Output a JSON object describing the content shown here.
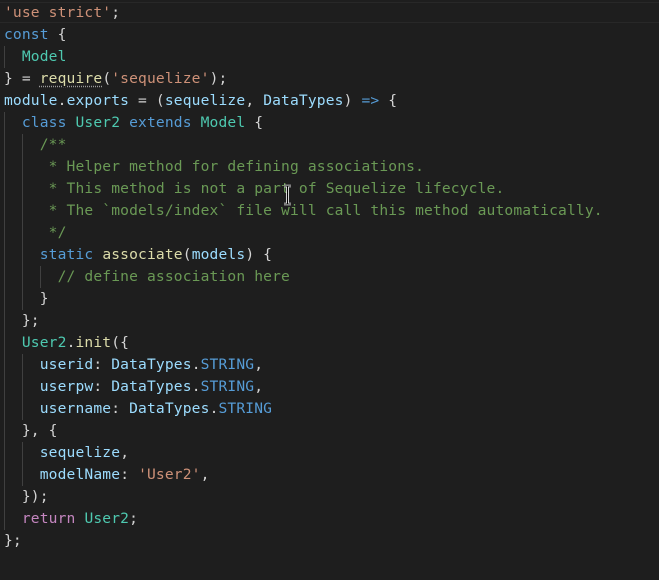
{
  "editor": {
    "theme": "vscode-dark",
    "background": "#1e1e1e",
    "lines": [
      [
        {
          "t": "'use strict'",
          "c": "str"
        },
        {
          "t": ";",
          "c": "pun"
        }
      ],
      [
        {
          "t": "const",
          "c": "kw"
        },
        {
          "t": " {",
          "c": "pun"
        }
      ],
      [
        {
          "t": "  ",
          "c": "pun"
        },
        {
          "t": "Model",
          "c": "cls"
        }
      ],
      [
        {
          "t": "} = ",
          "c": "pun"
        },
        {
          "t": "require",
          "c": "fn"
        },
        {
          "t": "(",
          "c": "pun"
        },
        {
          "t": "'sequelize'",
          "c": "str"
        },
        {
          "t": ");",
          "c": "pun"
        }
      ],
      [
        {
          "t": "module",
          "c": "var"
        },
        {
          "t": ".",
          "c": "pun"
        },
        {
          "t": "exports",
          "c": "var"
        },
        {
          "t": " = (",
          "c": "pun"
        },
        {
          "t": "sequelize",
          "c": "var"
        },
        {
          "t": ", ",
          "c": "pun"
        },
        {
          "t": "DataTypes",
          "c": "var"
        },
        {
          "t": ") ",
          "c": "pun"
        },
        {
          "t": "=>",
          "c": "kw"
        },
        {
          "t": " {",
          "c": "pun"
        }
      ],
      [
        {
          "t": "  ",
          "c": "pun"
        },
        {
          "t": "class",
          "c": "kw"
        },
        {
          "t": " ",
          "c": "pun"
        },
        {
          "t": "User2",
          "c": "cls"
        },
        {
          "t": " ",
          "c": "pun"
        },
        {
          "t": "extends",
          "c": "kw"
        },
        {
          "t": " ",
          "c": "pun"
        },
        {
          "t": "Model",
          "c": "cls"
        },
        {
          "t": " {",
          "c": "pun"
        }
      ],
      [
        {
          "t": "    /**",
          "c": "cmt"
        }
      ],
      [
        {
          "t": "     * Helper method for defining associations.",
          "c": "cmt"
        }
      ],
      [
        {
          "t": "     * This method is not a part of Sequelize lifecycle.",
          "c": "cmt"
        }
      ],
      [
        {
          "t": "     * The `models/index` file will call this method automatically.",
          "c": "cmt"
        }
      ],
      [
        {
          "t": "     */",
          "c": "cmt"
        }
      ],
      [
        {
          "t": "    ",
          "c": "pun"
        },
        {
          "t": "static",
          "c": "kw"
        },
        {
          "t": " ",
          "c": "pun"
        },
        {
          "t": "associate",
          "c": "fn"
        },
        {
          "t": "(",
          "c": "pun"
        },
        {
          "t": "models",
          "c": "var"
        },
        {
          "t": ") {",
          "c": "pun"
        }
      ],
      [
        {
          "t": "      ",
          "c": "pun"
        },
        {
          "t": "// define association here",
          "c": "cmt"
        }
      ],
      [
        {
          "t": "    }",
          "c": "pun"
        }
      ],
      [
        {
          "t": "  };",
          "c": "pun"
        }
      ],
      [
        {
          "t": "  ",
          "c": "pun"
        },
        {
          "t": "User2",
          "c": "cls"
        },
        {
          "t": ".",
          "c": "pun"
        },
        {
          "t": "init",
          "c": "fn"
        },
        {
          "t": "({",
          "c": "pun"
        }
      ],
      [
        {
          "t": "    ",
          "c": "pun"
        },
        {
          "t": "userid",
          "c": "var"
        },
        {
          "t": ": ",
          "c": "pun"
        },
        {
          "t": "DataTypes",
          "c": "var"
        },
        {
          "t": ".",
          "c": "pun"
        },
        {
          "t": "STRING",
          "c": "kw"
        },
        {
          "t": ",",
          "c": "pun"
        }
      ],
      [
        {
          "t": "    ",
          "c": "pun"
        },
        {
          "t": "userpw",
          "c": "var"
        },
        {
          "t": ": ",
          "c": "pun"
        },
        {
          "t": "DataTypes",
          "c": "var"
        },
        {
          "t": ".",
          "c": "pun"
        },
        {
          "t": "STRING",
          "c": "kw"
        },
        {
          "t": ",",
          "c": "pun"
        }
      ],
      [
        {
          "t": "    ",
          "c": "pun"
        },
        {
          "t": "username",
          "c": "var"
        },
        {
          "t": ": ",
          "c": "pun"
        },
        {
          "t": "DataTypes",
          "c": "var"
        },
        {
          "t": ".",
          "c": "pun"
        },
        {
          "t": "STRING",
          "c": "kw"
        }
      ],
      [
        {
          "t": "  }, {",
          "c": "pun"
        }
      ],
      [
        {
          "t": "    ",
          "c": "pun"
        },
        {
          "t": "sequelize",
          "c": "var"
        },
        {
          "t": ",",
          "c": "pun"
        }
      ],
      [
        {
          "t": "    ",
          "c": "pun"
        },
        {
          "t": "modelName",
          "c": "var"
        },
        {
          "t": ": ",
          "c": "pun"
        },
        {
          "t": "'User2'",
          "c": "str"
        },
        {
          "t": ",",
          "c": "pun"
        }
      ],
      [
        {
          "t": "  });",
          "c": "pun"
        }
      ],
      [
        {
          "t": "  ",
          "c": "pun"
        },
        {
          "t": "return",
          "c": "ctl"
        },
        {
          "t": " ",
          "c": "pun"
        },
        {
          "t": "User2",
          "c": "cls"
        },
        {
          "t": ";",
          "c": "pun"
        }
      ],
      [
        {
          "t": "};",
          "c": "pun"
        }
      ]
    ]
  }
}
